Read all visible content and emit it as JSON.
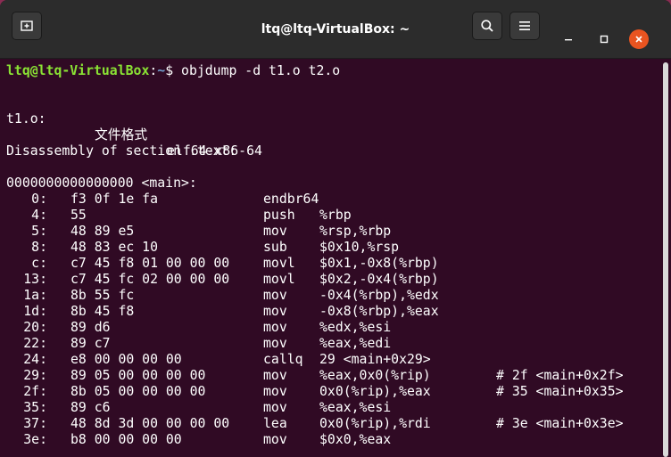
{
  "window": {
    "title": "ltq@ltq-VirtualBox: ~",
    "icons": {
      "new_tab": "new-tab-icon",
      "search": "search-icon",
      "menu": "hamburger-menu-icon",
      "minimize": "minimize-icon",
      "maximize": "maximize-icon",
      "close": "close-icon"
    },
    "colors": {
      "titlebar": "#2c2c2c",
      "terminal_bg": "#300a24",
      "prompt_user": "#8ae234",
      "prompt_path": "#729fcf",
      "close_button": "#e95420"
    }
  },
  "terminal": {
    "prompt": {
      "user_host": "ltq@ltq-VirtualBox",
      "separator": ":",
      "path": "~",
      "symbol": "$ ",
      "command": "objdump -d t1.o t2.o"
    },
    "file_line": {
      "file": "t1.o:",
      "format_label": "文件格式",
      "format": "elf64-x86-64"
    },
    "section_header": "Disassembly of section .text:",
    "symbol_header": "0000000000000000 <main>:",
    "instructions": [
      {
        "addr": "0:",
        "bytes": "f3 0f 1e fa",
        "mnemonic": "endbr64",
        "operands": "",
        "comment": ""
      },
      {
        "addr": "4:",
        "bytes": "55",
        "mnemonic": "push",
        "operands": "%rbp",
        "comment": ""
      },
      {
        "addr": "5:",
        "bytes": "48 89 e5",
        "mnemonic": "mov",
        "operands": "%rsp,%rbp",
        "comment": ""
      },
      {
        "addr": "8:",
        "bytes": "48 83 ec 10",
        "mnemonic": "sub",
        "operands": "$0x10,%rsp",
        "comment": ""
      },
      {
        "addr": "c:",
        "bytes": "c7 45 f8 01 00 00 00",
        "mnemonic": "movl",
        "operands": "$0x1,-0x8(%rbp)",
        "comment": ""
      },
      {
        "addr": "13:",
        "bytes": "c7 45 fc 02 00 00 00",
        "mnemonic": "movl",
        "operands": "$0x2,-0x4(%rbp)",
        "comment": ""
      },
      {
        "addr": "1a:",
        "bytes": "8b 55 fc",
        "mnemonic": "mov",
        "operands": "-0x4(%rbp),%edx",
        "comment": ""
      },
      {
        "addr": "1d:",
        "bytes": "8b 45 f8",
        "mnemonic": "mov",
        "operands": "-0x8(%rbp),%eax",
        "comment": ""
      },
      {
        "addr": "20:",
        "bytes": "89 d6",
        "mnemonic": "mov",
        "operands": "%edx,%esi",
        "comment": ""
      },
      {
        "addr": "22:",
        "bytes": "89 c7",
        "mnemonic": "mov",
        "operands": "%eax,%edi",
        "comment": ""
      },
      {
        "addr": "24:",
        "bytes": "e8 00 00 00 00",
        "mnemonic": "callq",
        "operands": "29 <main+0x29>",
        "comment": ""
      },
      {
        "addr": "29:",
        "bytes": "89 05 00 00 00 00",
        "mnemonic": "mov",
        "operands": "%eax,0x0(%rip)",
        "comment": "# 2f <main+0x2f>"
      },
      {
        "addr": "2f:",
        "bytes": "8b 05 00 00 00 00",
        "mnemonic": "mov",
        "operands": "0x0(%rip),%eax",
        "comment": "# 35 <main+0x35>"
      },
      {
        "addr": "35:",
        "bytes": "89 c6",
        "mnemonic": "mov",
        "operands": "%eax,%esi",
        "comment": ""
      },
      {
        "addr": "37:",
        "bytes": "48 8d 3d 00 00 00 00",
        "mnemonic": "lea",
        "operands": "0x0(%rip),%rdi",
        "comment": "# 3e <main+0x3e>"
      },
      {
        "addr": "3e:",
        "bytes": "b8 00 00 00 00",
        "mnemonic": "mov",
        "operands": "$0x0,%eax",
        "comment": ""
      }
    ]
  }
}
